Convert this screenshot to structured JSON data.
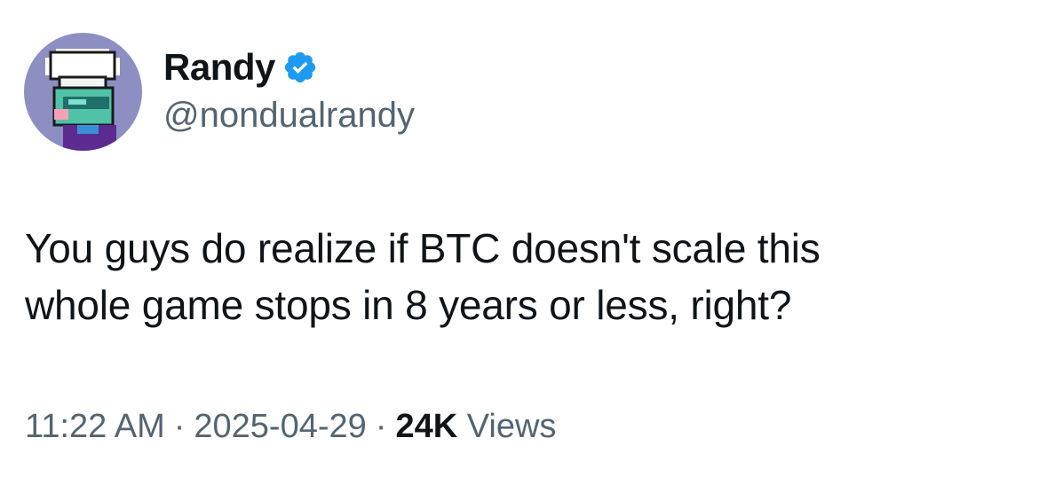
{
  "author": {
    "display_name": "Randy",
    "handle": "@nondualrandy",
    "verified_icon": "verified-badge-icon",
    "avatar_icon": "pixel-chef-avatar"
  },
  "tweet": {
    "text_line1": "You guys do realize if BTC doesn't scale this",
    "text_line2": "whole game stops in 8 years or less, right?"
  },
  "meta": {
    "time": "11:22 AM",
    "separator": "·",
    "date": "2025-04-29",
    "views_count": "24K",
    "views_label": "Views"
  },
  "colors": {
    "text_primary": "#0f1419",
    "text_secondary": "#536471",
    "verified_blue": "#1d9bf0",
    "avatar_bg": "#8d8fc2"
  }
}
